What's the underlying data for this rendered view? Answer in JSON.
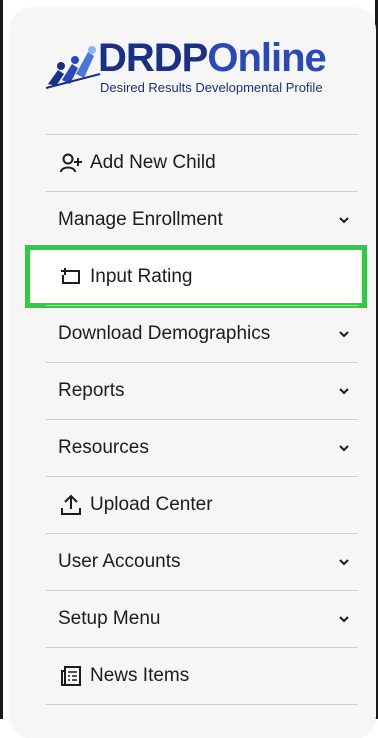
{
  "logo": {
    "word": "DRDPOnline",
    "subtitle": "Desired Results Developmental Profile"
  },
  "menu": {
    "items": [
      {
        "label": "Add New Child",
        "icon": "add-person-icon",
        "expandable": false
      },
      {
        "label": "Manage Enrollment",
        "icon": "",
        "expandable": true
      },
      {
        "label": "Input Rating",
        "icon": "input-rating-icon",
        "expandable": false,
        "highlighted": true
      },
      {
        "label": "Download Demographics",
        "icon": "",
        "expandable": true
      },
      {
        "label": "Reports",
        "icon": "",
        "expandable": true
      },
      {
        "label": "Resources",
        "icon": "",
        "expandable": true
      },
      {
        "label": "Upload Center",
        "icon": "upload-icon",
        "expandable": false
      },
      {
        "label": "User Accounts",
        "icon": "",
        "expandable": true
      },
      {
        "label": "Setup Menu",
        "icon": "",
        "expandable": true
      },
      {
        "label": "News Items",
        "icon": "news-icon",
        "expandable": false
      }
    ]
  },
  "colors": {
    "brand": "#1a2f86",
    "highlight": "#2ecc40"
  }
}
